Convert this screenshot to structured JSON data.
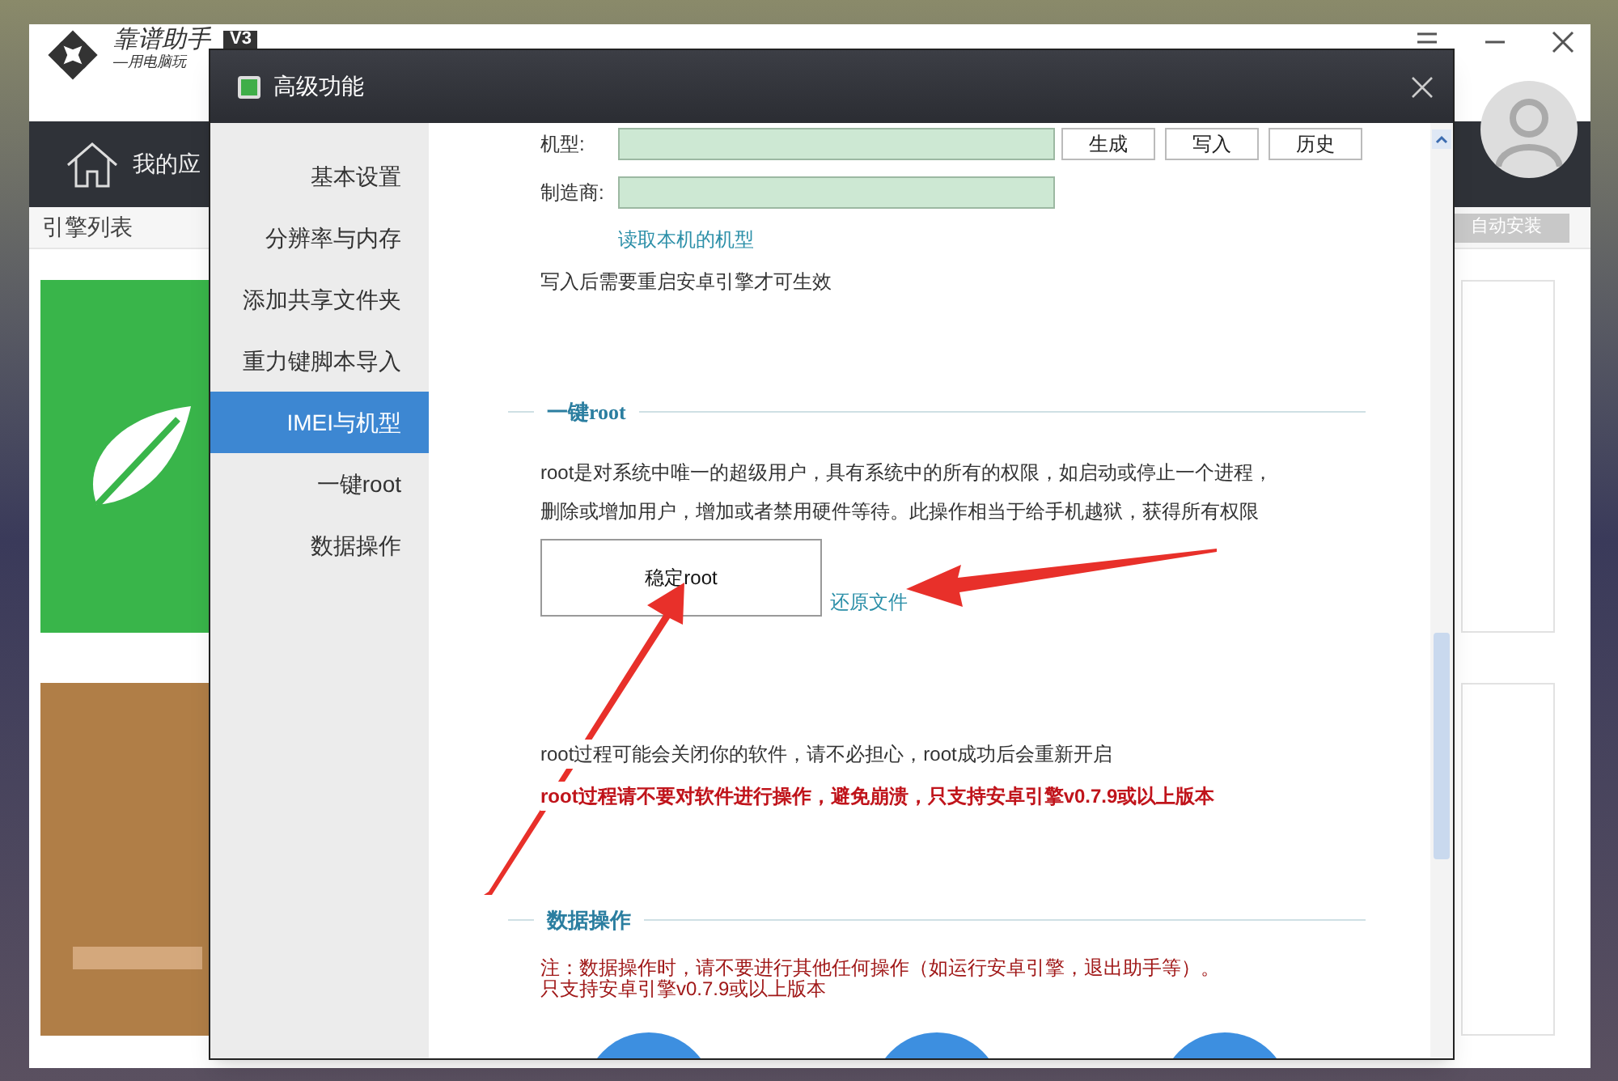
{
  "app": {
    "logo_title": "靠谱助手",
    "version": "V3",
    "slogan": "—用电脑玩",
    "nav_label": "我的应",
    "engine_list": "引擎列表",
    "auto_install": "自动安装"
  },
  "dialog": {
    "title": "高级功能",
    "sidebar": [
      {
        "label": "基本设置",
        "selected": false
      },
      {
        "label": "分辨率与内存",
        "selected": false
      },
      {
        "label": "添加共享文件夹",
        "selected": false
      },
      {
        "label": "重力键脚本导入",
        "selected": false
      },
      {
        "label": "IMEI与机型",
        "selected": true
      },
      {
        "label": "一键root",
        "selected": false
      },
      {
        "label": "数据操作",
        "selected": false
      }
    ],
    "imei": {
      "model_label": "机型:",
      "maker_label": "制造商:",
      "buttons": [
        "生成",
        "写入",
        "历史"
      ],
      "read_link": "读取本机的机型",
      "note": "写入后需要重启安卓引擎才可生效"
    },
    "root": {
      "heading": "一键root",
      "description": [
        "root是对系统中唯一的超级用户，具有系统中的所有的权限，如启动或停止一个进程，",
        "删除或增加用户，增加或者禁用硬件等待。此操作相当于给手机越狱，获得所有权限"
      ],
      "root_button": "稳定root",
      "restore_link": "还原文件",
      "info": "root过程可能会关闭你的软件，请不必担心，root成功后会重新开启",
      "warning": "root过程请不要对软件进行操作，避免崩溃，只支持安卓引擎v0.7.9或以上版本"
    },
    "data_section": {
      "heading": "数据操作",
      "notes": [
        "注：数据操作时，请不要进行其他任何操作（如运行安卓引擎，退出助手等）。",
        "只支持安卓引擎v0.7.9或以上版本"
      ]
    }
  }
}
